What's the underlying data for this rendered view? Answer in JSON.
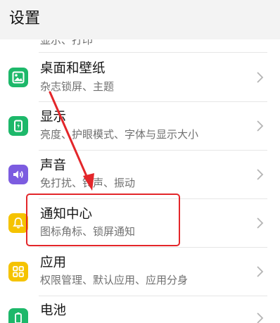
{
  "header": {
    "title": "设置"
  },
  "partial_item": {
    "subtitle": "显示、打印"
  },
  "items": [
    {
      "title": "桌面和壁纸",
      "subtitle": "杂志锁屏、主题",
      "icon": "wallpaper-icon",
      "color": "#1db86a"
    },
    {
      "title": "显示",
      "subtitle": "亮度、护眼模式、字体与显示大小",
      "icon": "display-icon",
      "color": "#1db86a"
    },
    {
      "title": "声音",
      "subtitle": "免打扰、铃声、振动",
      "icon": "sound-icon",
      "color": "#7c5ce0"
    },
    {
      "title": "通知中心",
      "subtitle": "图标角标、锁屏通知",
      "icon": "notification-icon",
      "color": "#f5c300"
    },
    {
      "title": "应用",
      "subtitle": "权限管理、默认应用、应用分身",
      "icon": "apps-icon",
      "color": "#f5c300"
    },
    {
      "title": "电池",
      "subtitle": "",
      "icon": "battery-icon",
      "color": "#1db86a"
    }
  ],
  "annotation": {
    "highlight_color": "#e3262a",
    "arrow_color": "#e3262a"
  }
}
